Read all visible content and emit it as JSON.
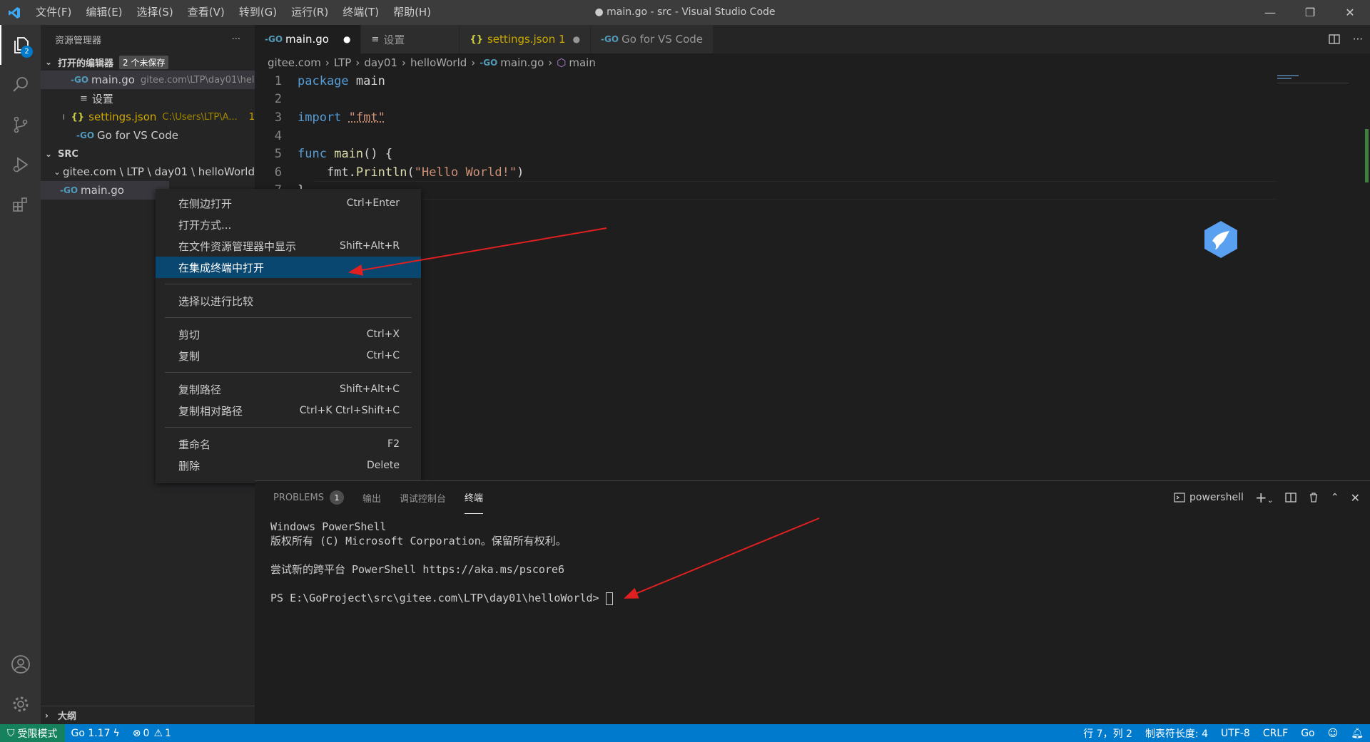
{
  "title_bar": {
    "menu": [
      "文件(F)",
      "编辑(E)",
      "选择(S)",
      "查看(V)",
      "转到(G)",
      "运行(R)",
      "终端(T)",
      "帮助(H)"
    ],
    "window_title": "● main.go - src - Visual Studio Code",
    "min": "—",
    "restore": "❐",
    "close": "✕"
  },
  "activity_bar": {
    "explorer_badge": "2"
  },
  "sidebar": {
    "title": "资源管理器",
    "more": "···",
    "open_editors": {
      "title": "打开的编辑器",
      "unsaved": "2 个未保存",
      "items": [
        {
          "name": "main.go",
          "desc": "gitee.com\\LTP\\day01\\hell..."
        },
        {
          "name": "设置",
          "desc": ""
        },
        {
          "name": "settings.json",
          "desc": "C:\\Users\\LTP\\A...",
          "count": "1"
        },
        {
          "name": "Go for VS Code",
          "desc": ""
        }
      ]
    },
    "src": {
      "title": "SRC",
      "folder": "gitee.com \\ LTP \\ day01 \\ helloWorld",
      "file": "main.go"
    },
    "outline": "大纲"
  },
  "tabs": [
    {
      "label": "main.go",
      "close": "●"
    },
    {
      "label": "设置"
    },
    {
      "label": "settings.json 1",
      "close": "●"
    },
    {
      "label": "Go for VS Code"
    }
  ],
  "breadcrumb": [
    "gitee.com",
    "LTP",
    "day01",
    "helloWorld",
    "main.go",
    "main"
  ],
  "code": {
    "line_numbers": [
      "1",
      "2",
      "3",
      "4",
      "5",
      "6",
      "7"
    ],
    "l1_kw": "package",
    "l1_rest": " main",
    "l3_kw": "import",
    "l3_str": "\"fmt\"",
    "l5_kw": "func",
    "l5_fn": "main",
    "l5_rest": "() {",
    "l6_pre": "    fmt.",
    "l6_fn": "Println",
    "l6_open": "(",
    "l6_str": "\"Hello World!\"",
    "l6_close": ")",
    "l7": "}"
  },
  "context_menu": {
    "items": [
      {
        "label": "在侧边打开",
        "kb": "Ctrl+Enter"
      },
      {
        "label": "打开方式...",
        "kb": ""
      },
      {
        "label": "在文件资源管理器中显示",
        "kb": "Shift+Alt+R"
      },
      {
        "label": "在集成终端中打开",
        "kb": ""
      },
      {
        "label": "选择以进行比较",
        "kb": ""
      },
      {
        "label": "剪切",
        "kb": "Ctrl+X"
      },
      {
        "label": "复制",
        "kb": "Ctrl+C"
      },
      {
        "label": "复制路径",
        "kb": "Shift+Alt+C"
      },
      {
        "label": "复制相对路径",
        "kb": "Ctrl+K Ctrl+Shift+C"
      },
      {
        "label": "重命名",
        "kb": "F2"
      },
      {
        "label": "删除",
        "kb": "Delete"
      }
    ]
  },
  "panel": {
    "tabs": {
      "problems": "PROBLEMS",
      "problems_count": "1",
      "output": "输出",
      "debug": "调试控制台",
      "terminal": "终端"
    },
    "shell": "powershell",
    "terminal_lines": [
      "Windows PowerShell",
      "版权所有 (C) Microsoft Corporation。保留所有权利。",
      "",
      "尝试新的跨平台 PowerShell https://aka.ms/pscore6",
      "",
      "PS E:\\GoProject\\src\\gitee.com\\LTP\\day01\\helloWorld> "
    ]
  },
  "status_bar": {
    "restricted": "受限模式",
    "go_version": "Go 1.17",
    "errors": "0",
    "warnings": "1",
    "position": "行 7，列 2",
    "tab_size": "制表符长度: 4",
    "encoding": "UTF-8",
    "eol": "CRLF",
    "language": "Go"
  },
  "colors": {
    "accent": "#007acc",
    "highlight": "#094771",
    "arrow": "#e02020"
  }
}
